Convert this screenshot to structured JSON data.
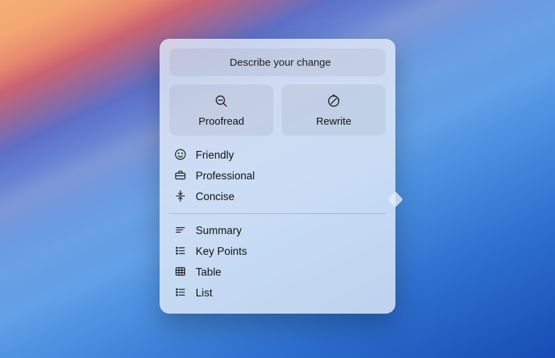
{
  "describe": {
    "label": "Describe your change"
  },
  "actions": {
    "proofread": "Proofread",
    "rewrite": "Rewrite"
  },
  "tones": [
    {
      "id": "friendly",
      "label": "Friendly"
    },
    {
      "id": "professional",
      "label": "Professional"
    },
    {
      "id": "concise",
      "label": "Concise"
    }
  ],
  "formats": [
    {
      "id": "summary",
      "label": "Summary"
    },
    {
      "id": "keypoints",
      "label": "Key Points"
    },
    {
      "id": "table",
      "label": "Table"
    },
    {
      "id": "list",
      "label": "List"
    }
  ]
}
